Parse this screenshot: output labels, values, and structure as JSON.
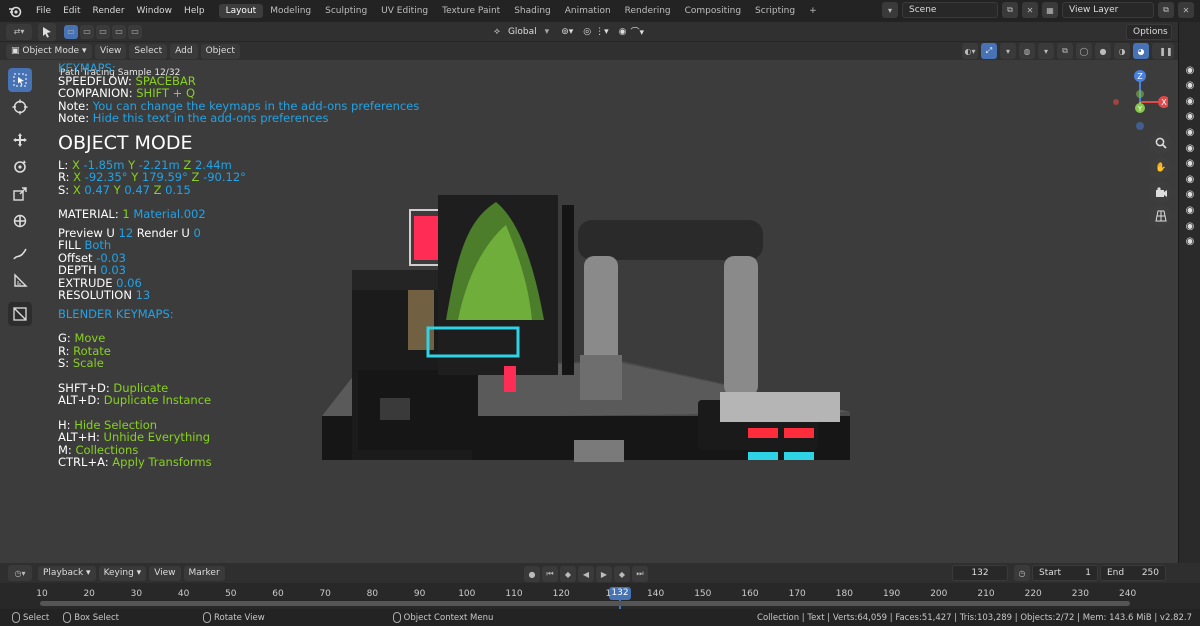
{
  "menu": [
    "File",
    "Edit",
    "Render",
    "Window",
    "Help"
  ],
  "workspaces": [
    "Layout",
    "Modeling",
    "Sculpting",
    "UV Editing",
    "Texture Paint",
    "Shading",
    "Animation",
    "Rendering",
    "Compositing",
    "Scripting"
  ],
  "add_tab": "+",
  "scene": "Scene",
  "view_layer": "View Layer",
  "header": {
    "orientation": "Global",
    "options": "Options"
  },
  "header3": {
    "mode": "Object Mode",
    "view": "View",
    "select": "Select",
    "add": "Add",
    "object": "Object"
  },
  "path_tracing": "Path Tracing Sample 12/32",
  "overlay": {
    "keymaps_title": "KEYMAPS:",
    "speedflow_k": "SPEEDFLOW: ",
    "speedflow_v": "SPACEBAR",
    "companion_k": "COMPANION: ",
    "companion_v": "SHIFT + Q",
    "note1_k": "Note: ",
    "note1_v": "You can change the keymaps in the add-ons preferences",
    "note2_k": "Note: ",
    "note2_v": "Hide this text in the add-ons preferences",
    "mode_title": "OBJECT MODE",
    "l_k": "L:  ",
    "l_x": "X",
    "l_xv": " -1.85m ",
    "l_y": "Y",
    "l_yv": " -2.21m ",
    "l_z": "Z",
    "l_zv": " 2.44m",
    "r_k": "R:  ",
    "r_x": "X",
    "r_xv": " -92.35° ",
    "r_y": "Y",
    "r_yv": " 179.59° ",
    "r_z": "Z",
    "r_zv": " -90.12°",
    "s_k": "S:  ",
    "s_x": "X",
    "s_xv": " 0.47 ",
    "s_y": "Y",
    "s_yv": " 0.47 ",
    "s_z": "Z",
    "s_zv": " 0.15",
    "material_k": "MATERIAL: ",
    "material_n": "1",
    "material_v": " Material.002",
    "preview_k": "Preview U ",
    "preview_v": "12",
    "render_k": " Render U ",
    "render_v": "0",
    "fill_k": "FILL ",
    "fill_v": "Both",
    "offset_k": "Offset ",
    "offset_v": "-0.03",
    "depth_k": "DEPTH ",
    "depth_v": "0.03",
    "extrude_k": "EXTRUDE ",
    "extrude_v": "0.06",
    "resolution_k": "RESOLUTION ",
    "resolution_v": "13",
    "blender_keymaps": "BLENDER KEYMAPS:",
    "g_k": "G: ",
    "g_v": "Move",
    "r2_k": "R: ",
    "r2_v": "Rotate",
    "s2_k": "S: ",
    "s2_v": "Scale",
    "shd_k": "SHFT+D: ",
    "shd_v": "Duplicate",
    "altd_k": "ALT+D: ",
    "altd_v": "Duplicate Instance",
    "h_k": "H: ",
    "h_v": "Hide Selection",
    "alth_k": "ALT+H: ",
    "alth_v": "Unhide Everything",
    "m_k": "M: ",
    "m_v": "Collections",
    "ctrla_k": "CTRL+A: ",
    "ctrla_v": "Apply Transforms"
  },
  "gizmo": {
    "z": "Z",
    "x": "X",
    "y": "Y"
  },
  "timeline": {
    "playback": "Playback",
    "keying": "Keying",
    "view": "View",
    "marker": "Marker",
    "current": "132",
    "start_k": "Start",
    "start_v": "1",
    "end_k": "End",
    "end_v": "250"
  },
  "ruler_ticks": [
    "10",
    "20",
    "30",
    "40",
    "50",
    "60",
    "70",
    "80",
    "90",
    "100",
    "110",
    "120",
    "1",
    "140",
    "150",
    "160",
    "170",
    "180",
    "190",
    "200",
    "210",
    "220",
    "230",
    "240"
  ],
  "current_frame": "132",
  "status": {
    "select": "Select",
    "box": "Box Select",
    "rotate": "Rotate View",
    "ctx": "Object Context Menu",
    "info": "Collection | Text | Verts:64,059 | Faces:51,427 | Tris:103,289 | Objects:2/72 | Mem: 143.6 MiB | v2.82.7"
  }
}
